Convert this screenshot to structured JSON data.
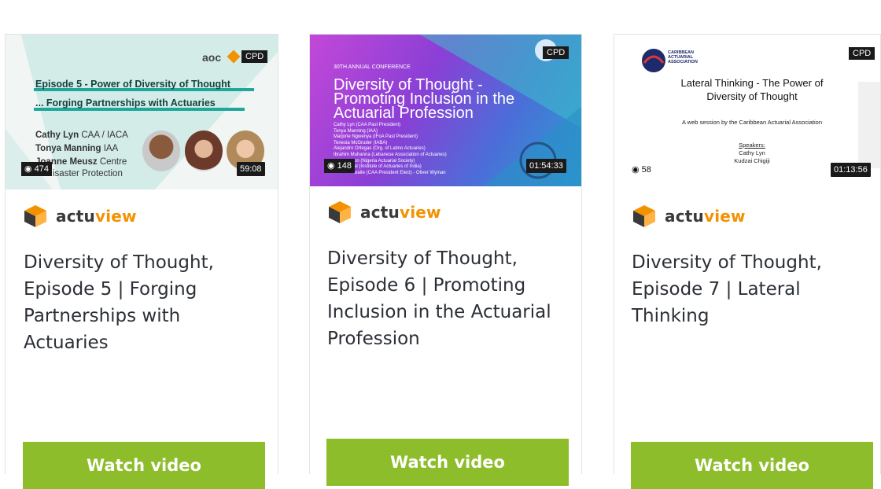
{
  "cards": [
    {
      "thumbnail": {
        "logo_text": "aoc",
        "cpd": "CPD",
        "episode_line1": "Episode 5 - Power of Diversity of Thought",
        "episode_line2": "... Forging Partnerships with Actuaries",
        "speakers": [
          {
            "name": "Cathy Lyn",
            "org": "CAA / IACA"
          },
          {
            "name": "Tonya Manning",
            "org": "IAA"
          },
          {
            "name": "Joanne Meusz",
            "org": "Centre"
          }
        ],
        "speaker_extra": "isaster Protection",
        "views": "474",
        "duration": "59:08"
      },
      "brand": {
        "actu": "actu",
        "view": "view"
      },
      "title": "Diversity of Thought, Episode 5 | Forging Partnerships with Actuaries",
      "button": "Watch video"
    },
    {
      "thumbnail": {
        "cpd": "CPD",
        "conference": "30TH ANNUAL CONFERENCE",
        "headline": "Diversity of Thought - Promoting Inclusion in the Actuarial Profession",
        "speakers": [
          "Cathy Lyn (CAA Past President)",
          "Tonya Manning (IAA)",
          "Marjorie Ngwenya (IFoA Past President)",
          "Tenesia McGruder (IABA)",
          "Alejandro Ortegas (Org. of Latino Actuaries)",
          "Ibrahim Muhanna (Lebanese Association of Actuaries)",
          "on (Nigeria Actuarial Society)",
          "al (Institute of Actuaries of India)",
          "waite (CAA President Elect) - Oliver Wyman"
        ],
        "views": "148",
        "duration": "01:54:33"
      },
      "brand": {
        "actu": "actu",
        "view": "view"
      },
      "title": "Diversity of Thought, Episode 6 | Promoting Inclusion in the Actuarial Profession",
      "button": "Watch video"
    },
    {
      "thumbnail": {
        "cpd": "CPD",
        "org_name": "CARIBBEAN ACTUARIAL ASSOCIATION",
        "headline": "Lateral Thinking - The Power of Diversity of Thought",
        "subline": "A web session by the Caribbean Actuarial Association",
        "speakers_label": "Speakers:",
        "speakers": [
          "Cathy Lyn",
          "Kudzai Chigiji"
        ],
        "views": "58",
        "duration": "01:13:56"
      },
      "brand": {
        "actu": "actu",
        "view": "view"
      },
      "title": "Diversity of Thought, Episode 7 | Lateral Thinking",
      "button": "Watch video"
    }
  ],
  "colors": {
    "accent": "#f39200",
    "button": "#8dbd2a",
    "text": "#2b2f36"
  }
}
